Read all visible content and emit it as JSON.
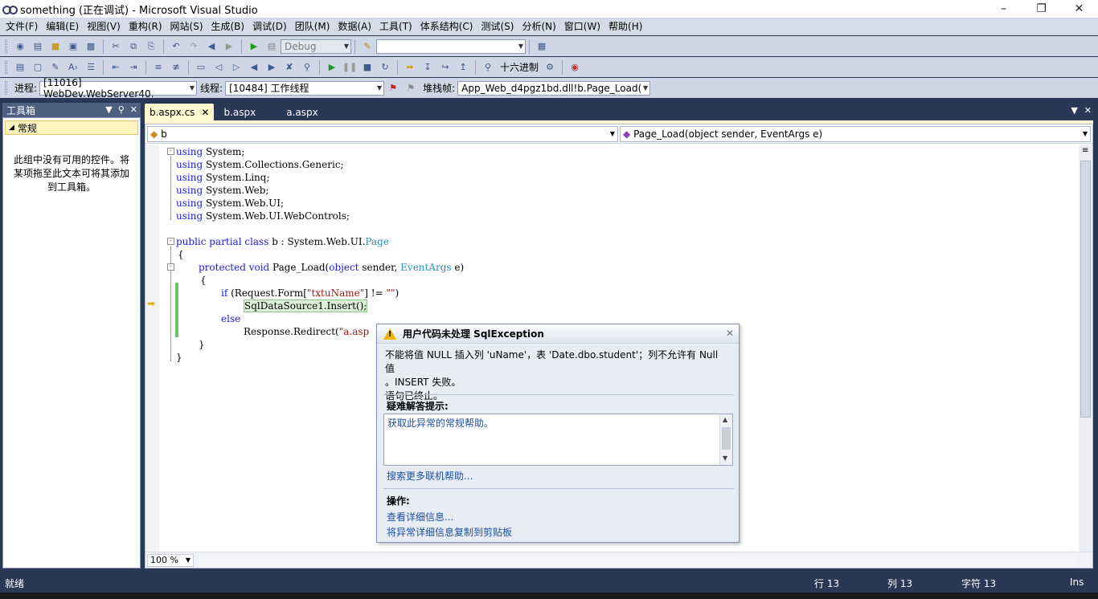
{
  "window": {
    "title": "something (正在调试) - Microsoft Visual Studio"
  },
  "menu": [
    "文件(F)",
    "编辑(E)",
    "视图(V)",
    "重构(R)",
    "网站(S)",
    "生成(B)",
    "调试(D)",
    "团队(M)",
    "数据(A)",
    "工具(T)",
    "体系结构(C)",
    "测试(S)",
    "分析(N)",
    "窗口(W)",
    "帮助(H)"
  ],
  "toolbar1": {
    "config": "Debug",
    "find": ""
  },
  "toolbar2": {
    "hex_label": "十六进制"
  },
  "toolbar3": {
    "process_label": "进程:",
    "process_value": "[11016] WebDev.WebServer40.",
    "thread_label": "线程:",
    "thread_value": "[10484] 工作线程",
    "stack_label": "堆栈帧:",
    "stack_value": "App_Web_d4pgz1bd.dll!b.Page_Load("
  },
  "toolbox": {
    "title": "工具箱",
    "group": "常规",
    "message": "此组中没有可用的控件。将某项拖至此文本可将其添加到工具箱。"
  },
  "tabs": [
    {
      "label": "b.aspx.cs",
      "active": true
    },
    {
      "label": "b.aspx"
    },
    {
      "label": "a.aspx"
    }
  ],
  "navbar": {
    "class_combo": "b",
    "member_combo": "Page_Load(object sender, EventArgs e)"
  },
  "code": {
    "l1_kw": "using",
    "l1_rest": " System;",
    "l2_kw": "using",
    "l2_rest": " System.Collections.Generic;",
    "l3_kw": "using",
    "l3_rest": " System.Linq;",
    "l4_kw": "using",
    "l4_rest": " System.Web;",
    "l5_kw": "using",
    "l5_rest": " System.Web.UI;",
    "l6_kw": "using",
    "l6_rest": " System.Web.UI.WebControls;",
    "l8_kw": "public partial class",
    "l8_name": " b : System.Web.UI.",
    "l8_type": "Page",
    "l9": "{",
    "l10_kw": "protected void",
    "l10_name": " Page_Load(",
    "l10_kw2": "object",
    "l10_mid": " sender, ",
    "l10_type": "EventArgs",
    "l10_end": " e)",
    "l11": "{",
    "l12_kw": "if",
    "l12_a": " (Request.Form[",
    "l12_str": "\"txtuName\"",
    "l12_b": "] != ",
    "l12_str2": "\"\"",
    "l12_c": ")",
    "l13": "SqlDataSource1.Insert();",
    "l14_kw": "else",
    "l15_a": "Response.Redirect(",
    "l15_str": "\"a.asp",
    "l16": "}",
    "l17": "}"
  },
  "zoom": "100 %",
  "exception": {
    "title": "用户代码未处理 SqlException",
    "line1": "不能将值 NULL 插入列 'uName'，表 'Date.dbo.student'；列不允许有 Null 值",
    "line2": "。INSERT 失败。",
    "line3": "语句已终止。",
    "tips_title": "疑难解答提示:",
    "tip1": "获取此异常的常规帮助。",
    "more_help": "搜索更多联机帮助...",
    "actions_title": "操作:",
    "action1": "查看详细信息...",
    "action2": "将异常详细信息复制到剪贴板"
  },
  "status": {
    "ready": "就绪",
    "line": "行 13",
    "col": "列 13",
    "char": "字符 13",
    "mode": "Ins"
  }
}
